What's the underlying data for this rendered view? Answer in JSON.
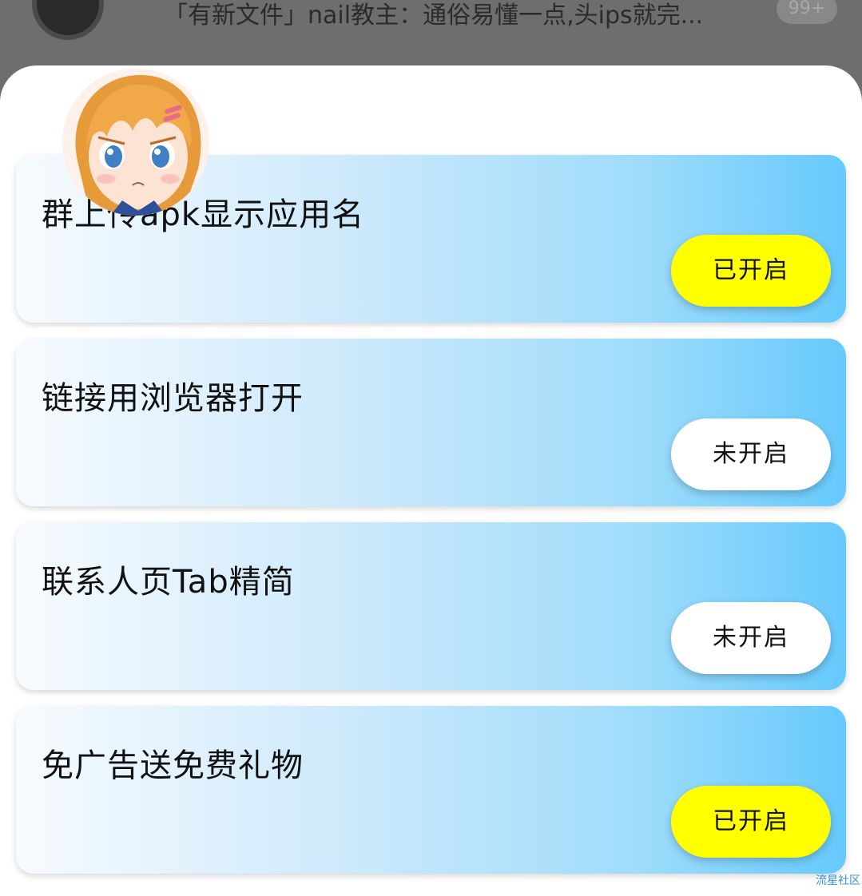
{
  "background_chat": {
    "preview_text": "「有新文件」nail教主：通俗易懂一点,头ips就完...",
    "badge": "99+"
  },
  "settings": [
    {
      "title": "群上传apk显示应用名",
      "status": "已开启",
      "enabled": true
    },
    {
      "title": "链接用浏览器打开",
      "status": "未开启",
      "enabled": false
    },
    {
      "title": "联系人页Tab精简",
      "status": "未开启",
      "enabled": false
    },
    {
      "title": "免广告送免费礼物",
      "status": "已开启",
      "enabled": true
    }
  ],
  "watermark": "流星社区",
  "colors": {
    "toggle_on": "#ffff00",
    "toggle_off": "#ffffff",
    "card_gradient_start": "#f7fbff",
    "card_gradient_end": "#66c9fc"
  }
}
